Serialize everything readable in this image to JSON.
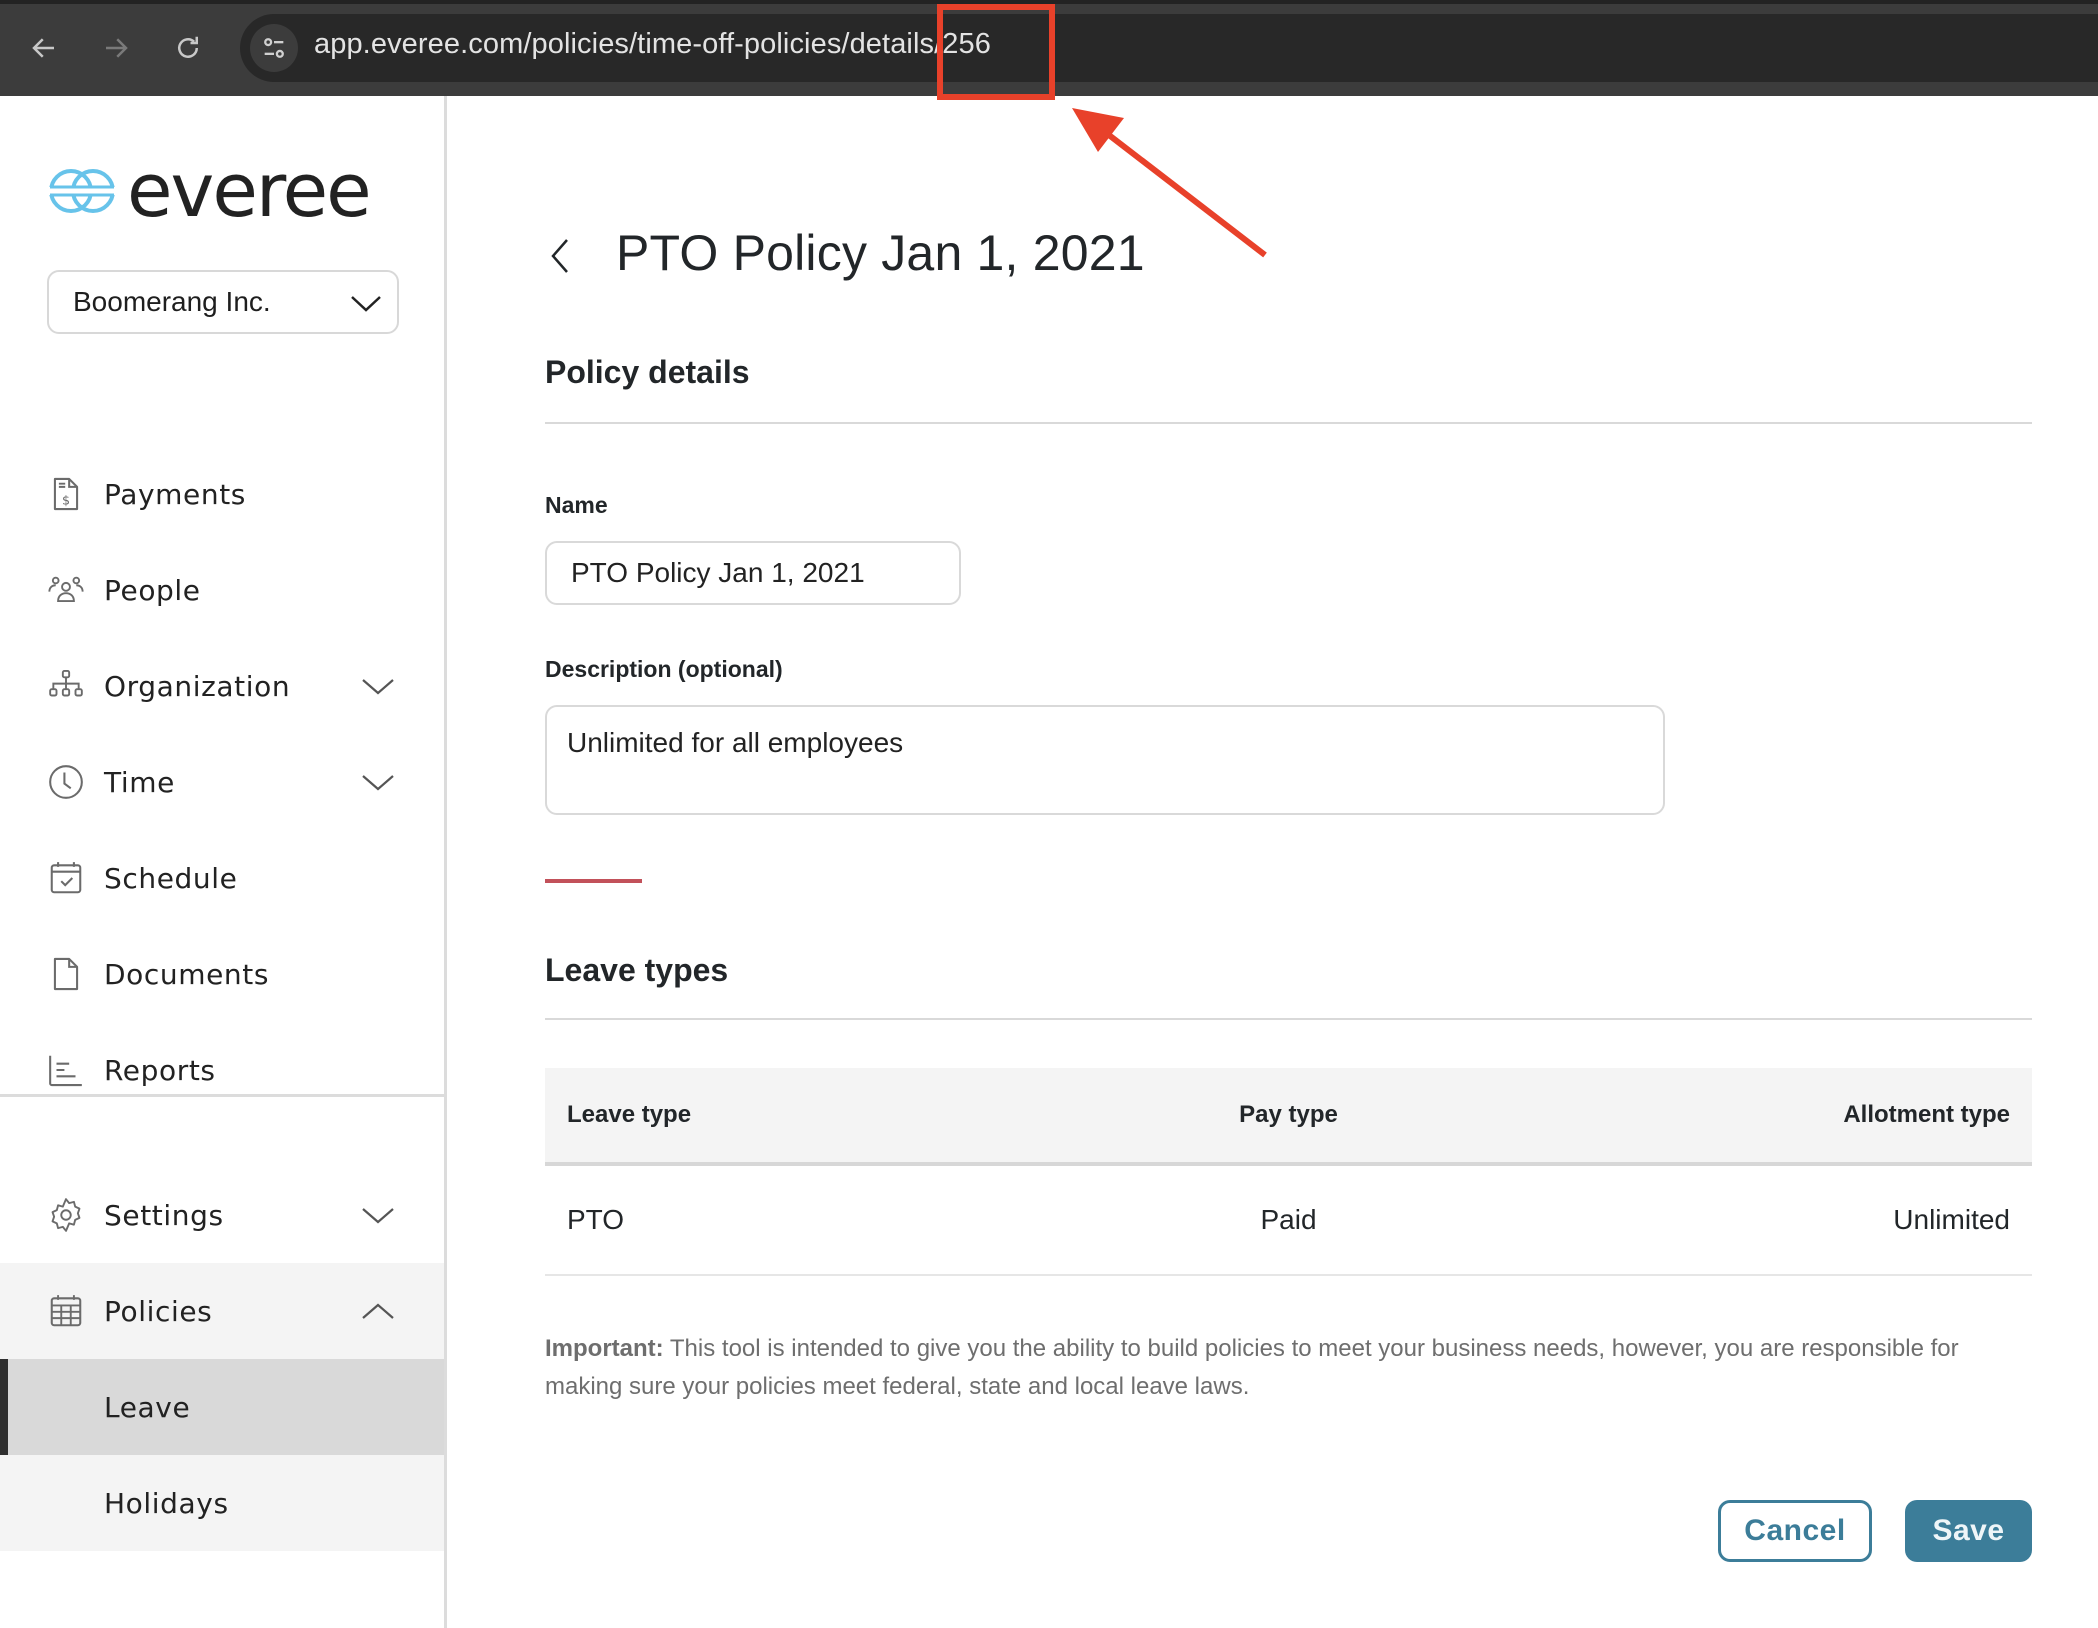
{
  "browser": {
    "url": "app.everee.com/policies/time-off-policies/details/256",
    "back_icon": "arrow-left-icon",
    "forward_icon": "arrow-right-icon",
    "reload_icon": "reload-icon",
    "site_info_icon": "tune-icon"
  },
  "annotation": {
    "highlight_color": "#e8412a",
    "highlighted_text": "s/256"
  },
  "sidebar": {
    "logo_text": "everee",
    "logo_color": "#67c3ea",
    "org_selector": {
      "value": "Boomerang Inc."
    },
    "items": [
      {
        "label": "Payments",
        "icon": "payments-doc-icon",
        "has_chevron": false
      },
      {
        "label": "People",
        "icon": "people-icon",
        "has_chevron": false
      },
      {
        "label": "Organization",
        "icon": "org-chart-icon",
        "has_chevron": true,
        "expanded": false
      },
      {
        "label": "Time",
        "icon": "clock-icon",
        "has_chevron": true,
        "expanded": false
      },
      {
        "label": "Schedule",
        "icon": "calendar-check-icon",
        "has_chevron": false
      },
      {
        "label": "Documents",
        "icon": "document-icon",
        "has_chevron": false
      },
      {
        "label": "Reports",
        "icon": "reports-icon",
        "has_chevron": false
      }
    ],
    "bottom_items": [
      {
        "label": "Settings",
        "icon": "gear-icon",
        "has_chevron": true,
        "expanded": false
      },
      {
        "label": "Policies",
        "icon": "calendar-grid-icon",
        "has_chevron": true,
        "expanded": true,
        "children": [
          {
            "label": "Leave",
            "active": true
          },
          {
            "label": "Holidays",
            "active": false
          }
        ]
      }
    ]
  },
  "main": {
    "title": "PTO Policy Jan 1, 2021",
    "policy_details": {
      "heading": "Policy details",
      "name_label": "Name",
      "name_value": "PTO Policy Jan 1, 2021",
      "description_label": "Description (optional)",
      "description_value": "Unlimited for all employees"
    },
    "leave_types": {
      "heading": "Leave types",
      "columns": [
        "Leave type",
        "Pay type",
        "Allotment type"
      ],
      "rows": [
        [
          "PTO",
          "Paid",
          "Unlimited"
        ]
      ]
    },
    "notice": {
      "prefix": "Important:",
      "text": " This tool is intended to give you the ability to build policies to meet your business needs, however, you are responsible for making sure your policies meet federal, state and local leave laws."
    },
    "actions": {
      "cancel_label": "Cancel",
      "save_label": "Save",
      "accent_color": "#3c7d99"
    }
  }
}
